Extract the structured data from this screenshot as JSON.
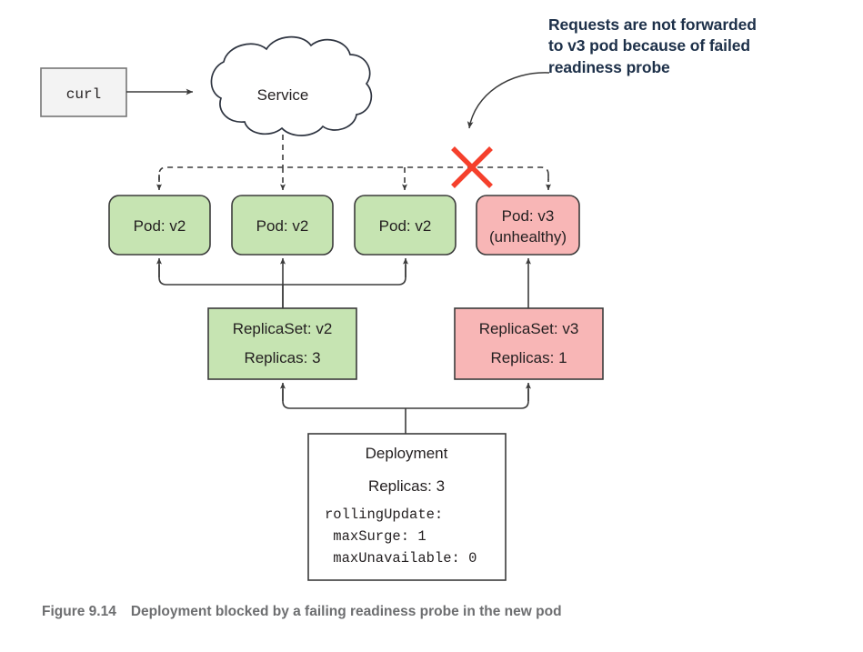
{
  "figure": {
    "caption_label": "Figure 9.14",
    "caption_text": "Deployment blocked by a failing readiness probe in the new pod"
  },
  "annotation": {
    "line1": "Requests are not forwarded",
    "line2": "to v3 pod because of failed",
    "line3": "readiness probe"
  },
  "client": {
    "label": "curl"
  },
  "service": {
    "label": "Service"
  },
  "pods": [
    {
      "label": "Pod: v2",
      "status": "healthy"
    },
    {
      "label": "Pod: v2",
      "status": "healthy"
    },
    {
      "label": "Pod: v2",
      "status": "healthy"
    },
    {
      "label": "Pod: v3",
      "sublabel": "(unhealthy)",
      "status": "unhealthy"
    }
  ],
  "replicasets": [
    {
      "title": "ReplicaSet: v2",
      "replicas": "Replicas: 3",
      "status": "healthy"
    },
    {
      "title": "ReplicaSet: v3",
      "replicas": "Replicas: 1",
      "status": "unhealthy"
    }
  ],
  "deployment": {
    "title": "Deployment",
    "replicas": "Replicas: 3",
    "spec_line1": "rollingUpdate:",
    "spec_line2": " maxSurge: 1",
    "spec_line3": " maxUnavailable: 0"
  },
  "marks": {
    "blocked_route": "X"
  },
  "colors": {
    "healthy_fill": "#c6e4b2",
    "unhealthy_fill": "#f8b6b6",
    "node_stroke": "#3b3b3b",
    "blocked_mark": "#f5402c",
    "annotation_text": "#1d3049",
    "caption_text": "#6d6e70"
  }
}
